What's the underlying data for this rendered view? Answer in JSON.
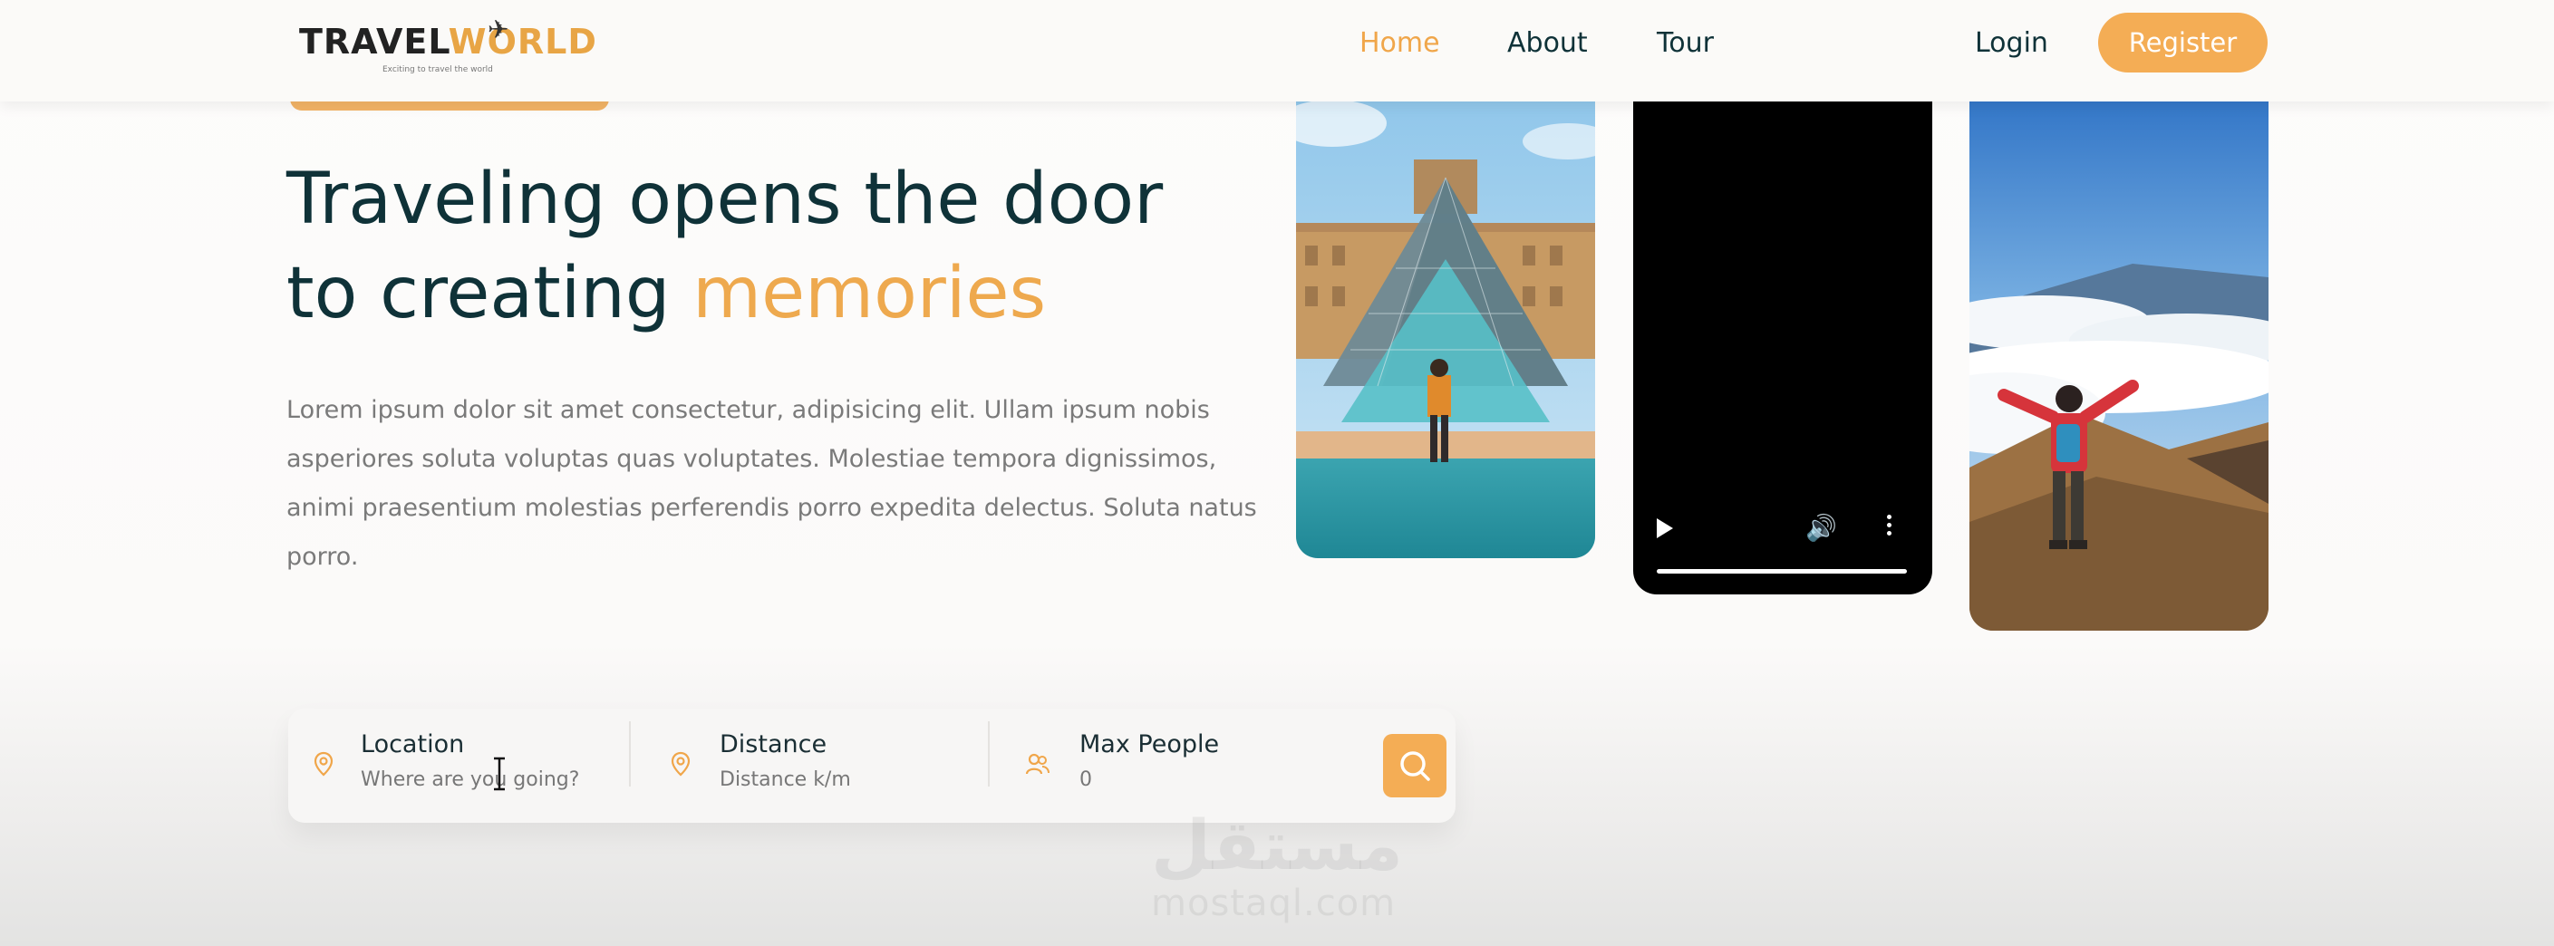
{
  "brand": {
    "logo_part1": "TRAVEL",
    "logo_part2": "WORLD",
    "tagline": "Exciting to travel the world"
  },
  "nav": {
    "items": [
      {
        "label": "Home",
        "active": true
      },
      {
        "label": "About",
        "active": false
      },
      {
        "label": "Tour",
        "active": false
      }
    ],
    "login_label": "Login",
    "register_label": "Register"
  },
  "hero": {
    "title_line1": "Traveling opens the door",
    "title_line2_prefix": "to creating ",
    "title_highlight": "memories",
    "description": "Lorem ipsum dolor sit amet consectetur, adipisicing elit. Ullam ipsum nobis asperiores soluta voluptas quas voluptates. Molestiae tempora dignissimos, animi praesentium molestias perferendis porro expedita delectus. Soluta natus porro."
  },
  "search": {
    "location": {
      "label": "Location",
      "placeholder": "Where are you going?",
      "icon": "location-pin-icon"
    },
    "distance": {
      "label": "Distance",
      "placeholder": "Distance k/m",
      "icon": "location-pin-icon"
    },
    "max_people": {
      "label": "Max People",
      "placeholder": "0",
      "icon": "people-icon"
    },
    "button_icon": "search-icon"
  },
  "watermark": {
    "arabic": "مستقل",
    "latin": "mostaql.com"
  },
  "colors": {
    "accent": "#f4ad55",
    "heading": "#0f3238",
    "text_muted": "#7a7a7a"
  }
}
